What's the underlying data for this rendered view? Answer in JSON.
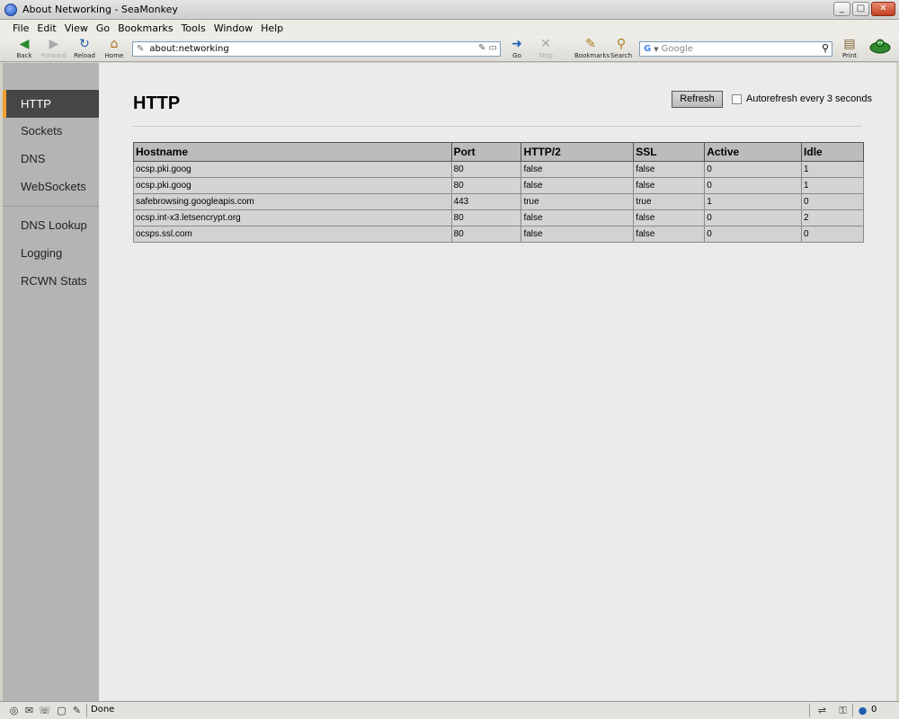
{
  "window": {
    "title": "About Networking - SeaMonkey",
    "buttons": [
      "_",
      "□",
      "✕"
    ]
  },
  "menu": [
    "File",
    "Edit",
    "View",
    "Go",
    "Bookmarks",
    "Tools",
    "Window",
    "Help"
  ],
  "toolbar": {
    "back": "Back",
    "forward": "Forward",
    "reload": "Reload",
    "home": "Home",
    "go": "Go",
    "stop": "Stop",
    "bookmarks": "Bookmarks",
    "search": "Search",
    "print": "Print",
    "url": "about:networking",
    "search_engine": "Google",
    "icons": {
      "back": "back-arrow-icon",
      "forward": "forward-arrow-icon",
      "reload": "reload-icon",
      "home": "home-icon",
      "go": "go-icon",
      "stop": "stop-icon",
      "bookmarks": "bookmarks-icon",
      "search": "search-icon",
      "print": "print-icon"
    }
  },
  "sidebar": {
    "items": [
      "HTTP",
      "Sockets",
      "DNS",
      "WebSockets",
      "DNS Lookup",
      "Logging",
      "RCWN Stats"
    ],
    "selected": "HTTP",
    "accent": "#f0a030"
  },
  "main": {
    "title": "HTTP",
    "refresh_label": "Refresh",
    "autorefresh_label": "Autorefresh every 3 seconds",
    "autorefresh_checked": false,
    "table": {
      "headers": [
        "Hostname",
        "Port",
        "HTTP/2",
        "SSL",
        "Active",
        "Idle"
      ],
      "rows": [
        [
          "ocsp.pki.goog",
          "80",
          "false",
          "false",
          "0",
          "1"
        ],
        [
          "ocsp.pki.goog",
          "80",
          "false",
          "false",
          "0",
          "1"
        ],
        [
          "safebrowsing.googleapis.com",
          "443",
          "true",
          "true",
          "1",
          "0"
        ],
        [
          "ocsp.int-x3.letsencrypt.org",
          "80",
          "false",
          "false",
          "0",
          "2"
        ],
        [
          "ocsps.ssl.com",
          "80",
          "false",
          "false",
          "0",
          "0"
        ]
      ]
    }
  },
  "statusbar": {
    "status": "Done",
    "count": "0"
  }
}
